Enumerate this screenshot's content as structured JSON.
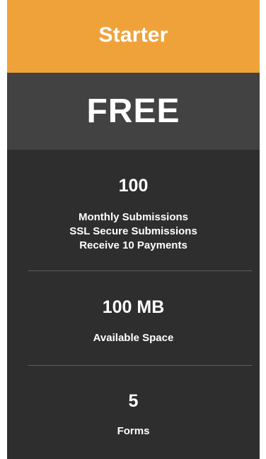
{
  "plan": {
    "name": "Starter",
    "price": "FREE"
  },
  "features": [
    {
      "value": "100",
      "lines": [
        "Monthly Submissions",
        "SSL Secure Submissions",
        "Receive 10 Payments"
      ]
    },
    {
      "value": "100 MB",
      "lines": [
        "Available Space"
      ]
    },
    {
      "value": "5",
      "lines": [
        "Forms"
      ]
    }
  ],
  "colors": {
    "header": "#f0a23a",
    "price_band": "#424242",
    "body": "#2e2e2e",
    "text": "#ffffff"
  }
}
